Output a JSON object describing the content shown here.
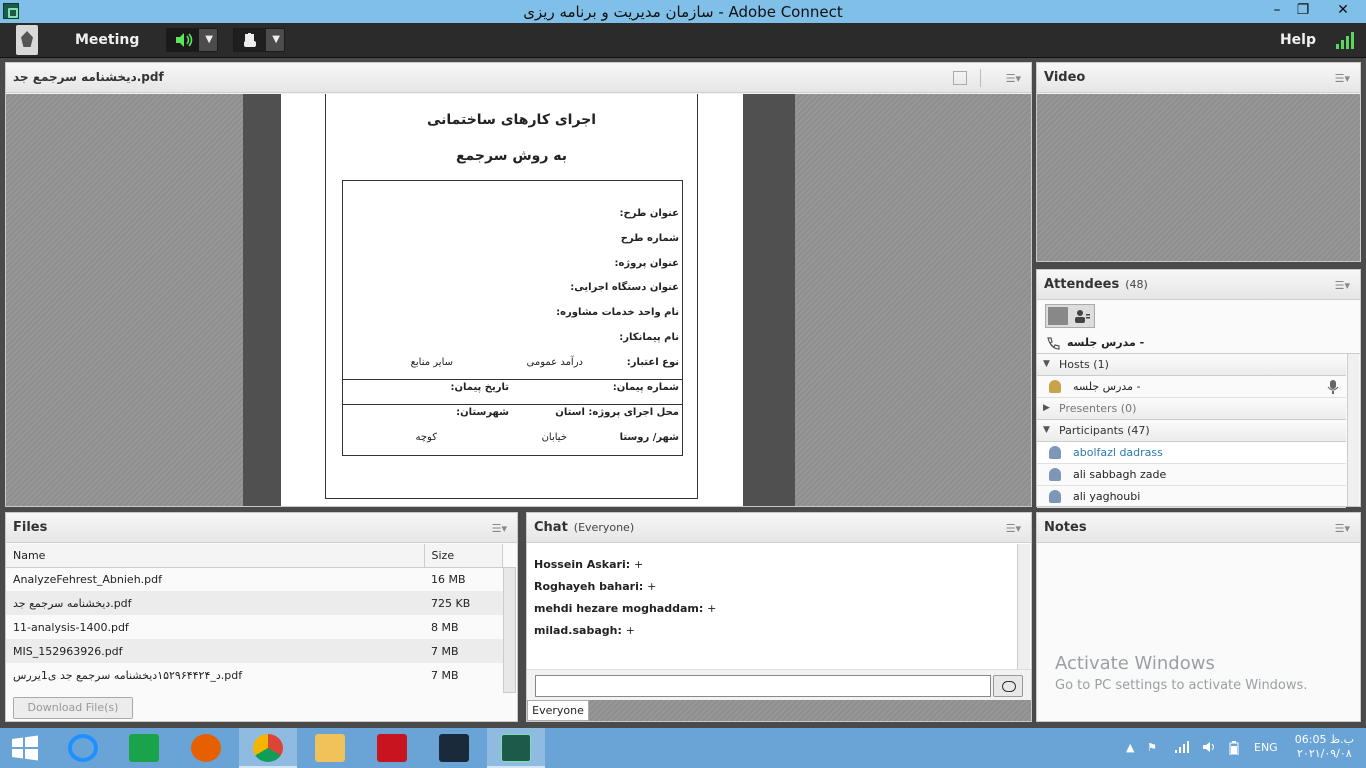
{
  "window": {
    "title": "سازمان مدیریت و برنامه ریزی - Adobe Connect"
  },
  "toolbar": {
    "meeting_label": "Meeting",
    "help_label": "Help"
  },
  "share_pod": {
    "title": "دیخشنامه سرجمع جد.pdf",
    "doc": {
      "heading1": "اجرای کارهای ساختمانی",
      "heading2": "به روش سرجمع",
      "fields": {
        "project_title": "عنوان طرح:",
        "project_number": "شماره طرح",
        "work_title": "عنوان پروژه:",
        "executor": "عنوان دستگاه اجرایی:",
        "consultant": "نام واحد خدمات مشاوره:",
        "contractor": "نام پیمانکار:",
        "credit_type": "نوع اعتبار:",
        "credit_general": "درآمد عمومی",
        "credit_other": "سایر منابع",
        "contract_number": "شماره پیمان:",
        "contract_date": "تاریخ پیمان:",
        "location": "محل اجرای پروژه: استان",
        "county": "شهرستان:",
        "city": "شهر/ روستا",
        "street": "خیابان",
        "alley": "کوچه"
      }
    }
  },
  "video_pod": {
    "title": "Video"
  },
  "attendees_pod": {
    "title": "Attendees",
    "count": "(48)",
    "top_user": "مدرس جلسه -",
    "sections": {
      "hosts": "Hosts (1)",
      "presenters": "Presenters (0)",
      "participants": "Participants (47)"
    },
    "host_name": "مدرس جلسه -",
    "participants": [
      "abolfazl dadrass",
      "ali sabbagh zade",
      "ali yaghoubi"
    ]
  },
  "files_pod": {
    "title": "Files",
    "columns": [
      "Name",
      "Size"
    ],
    "rows": [
      {
        "name": "AnalyzeFehrest_Abnieh.pdf",
        "size": "16 MB"
      },
      {
        "name": "دیخشنامه سرجمع جد.pdf",
        "size": "725 KB"
      },
      {
        "name": "11-analysis-1400.pdf",
        "size": "8 MB"
      },
      {
        "name": "MIS_152963926.pdf",
        "size": "7 MB"
      },
      {
        "name": "د_۱۵۲۹۶۴۴۲۴دیخشنامه سرجمع جد ی1یررس.pdf",
        "size": "7 MB"
      }
    ],
    "download_label": "Download File(s)"
  },
  "chat_pod": {
    "title": "Chat",
    "audience": "(Everyone)",
    "messages": [
      {
        "author": "Hossein Askari:",
        "text": "+"
      },
      {
        "author": "Roghayeh bahari:",
        "text": "+"
      },
      {
        "author": "mehdi hezare moghaddam:",
        "text": "+"
      },
      {
        "author": "milad.sabagh:",
        "text": "+"
      }
    ],
    "input_value": "",
    "tab_label": "Everyone"
  },
  "notes_pod": {
    "title": "Notes",
    "watermark_title": "Activate Windows",
    "watermark_sub": "Go to PC settings to activate Windows."
  },
  "taskbar": {
    "lang": "ENG",
    "time": "06:05 ب.ظ",
    "date": "۲۰۲۱/۰۹/۰۸"
  }
}
